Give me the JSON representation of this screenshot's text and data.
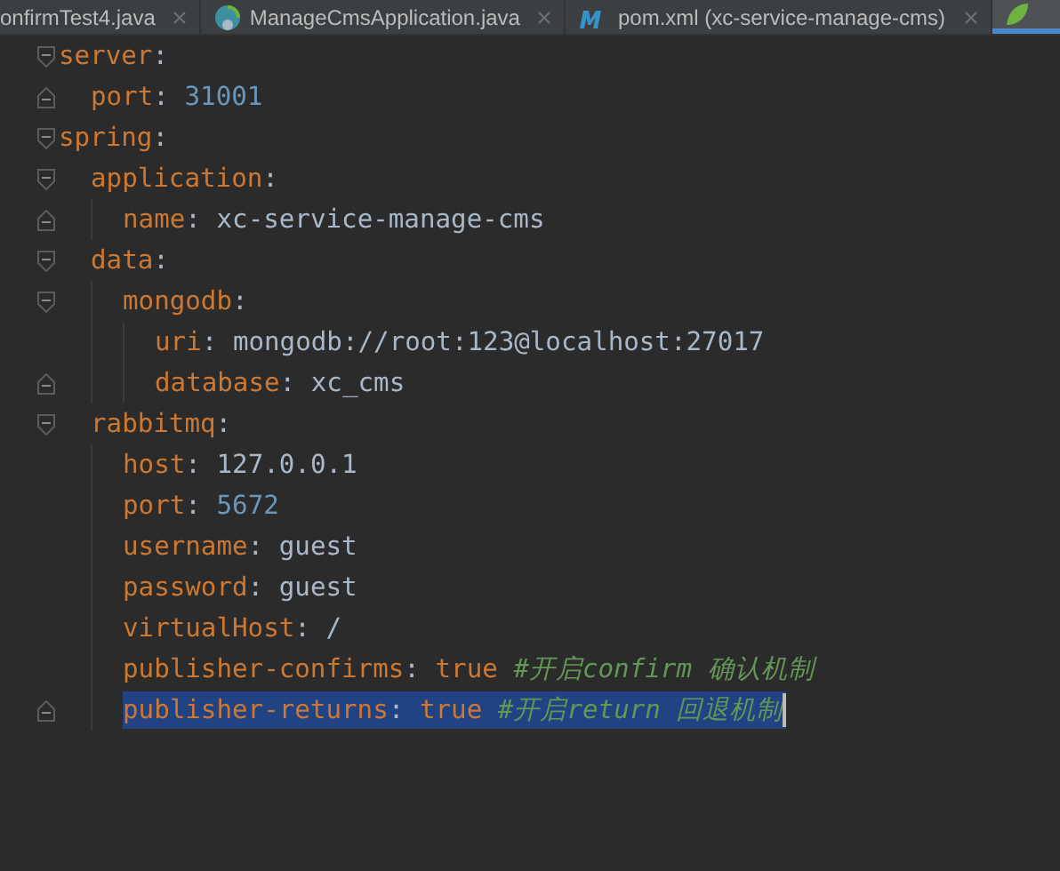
{
  "tabs": [
    {
      "label": "onfirmTest4.java",
      "kind": "plain",
      "selected": false
    },
    {
      "label": "ManageCmsApplication.java",
      "kind": "spring",
      "selected": false
    },
    {
      "label": "pom.xml (xc-service-manage-cms)",
      "kind": "maven",
      "selected": false
    },
    {
      "kind": "leaf",
      "selected": true
    }
  ],
  "editor": {
    "lines": [
      {
        "key": "server",
        "sep": ":",
        "children": [
          {
            "key": "port",
            "sep": ":",
            "value": "31001",
            "kind": "number"
          }
        ]
      },
      {
        "key": "spring",
        "sep": ":",
        "children": [
          {
            "key": "application",
            "sep": ":",
            "children": [
              {
                "key": "name",
                "sep": ":",
                "value": "xc-service-manage-cms",
                "kind": "string"
              }
            ]
          },
          {
            "key": "data",
            "sep": ":",
            "children": [
              {
                "key": "mongodb",
                "sep": ":",
                "children": [
                  {
                    "key": "uri",
                    "sep": ":",
                    "value": "mongodb://root:123@localhost:27017",
                    "kind": "string"
                  },
                  {
                    "key": "database",
                    "sep": ":",
                    "value": "xc_cms",
                    "kind": "string"
                  }
                ]
              }
            ]
          },
          {
            "key": "rabbitmq",
            "sep": ":",
            "children": [
              {
                "key": "host",
                "sep": ":",
                "value": "127.0.0.1",
                "kind": "string"
              },
              {
                "key": "port",
                "sep": ":",
                "value": "5672",
                "kind": "number"
              },
              {
                "key": "username",
                "sep": ":",
                "value": "guest",
                "kind": "string"
              },
              {
                "key": "password",
                "sep": ":",
                "value": "guest",
                "kind": "string"
              },
              {
                "key": "virtualHost",
                "sep": ":",
                "value": "/",
                "kind": "string"
              },
              {
                "key": "publisher-confirms",
                "sep": ":",
                "value": "true",
                "kind": "boolean",
                "comment": "#开启confirm 确认机制",
                "selected": false
              },
              {
                "key": "publisher-returns",
                "sep": ":",
                "value": "true",
                "kind": "boolean",
                "comment": "#开启return 回退机制",
                "selected": true
              }
            ]
          }
        ]
      }
    ]
  }
}
